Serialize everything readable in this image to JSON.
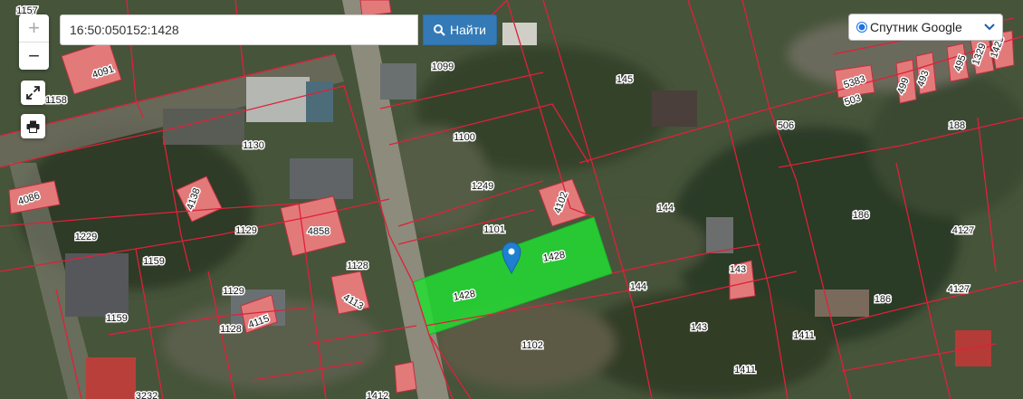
{
  "search": {
    "value": "16:50:050152:1428",
    "button_label": "Найти"
  },
  "map_controls": {
    "zoom_in": "+",
    "zoom_out": "−"
  },
  "layer": {
    "selected": "Спутник Google"
  },
  "plot_labels": [
    "1157",
    "4091",
    "1099",
    "145",
    "1158",
    "1100",
    "506",
    "188",
    "1130",
    "5383",
    "503",
    "499",
    "493",
    "495",
    "1329",
    "1425",
    "4086",
    "4138",
    "1249",
    "4102",
    "144",
    "186",
    "4127",
    "1229",
    "1129",
    "4858",
    "1101",
    "1428",
    "1159",
    "1128",
    "143",
    "1129",
    "4113",
    "1428",
    "144",
    "4127",
    "186",
    "1159",
    "4115",
    "1128",
    "143",
    "1411",
    "1102",
    "1411",
    "1412",
    "3232"
  ],
  "colors": {
    "selected_plot": "#22dd33",
    "boundary": "#e0203a",
    "building": "#e37a7a",
    "accent": "#337ab7"
  }
}
